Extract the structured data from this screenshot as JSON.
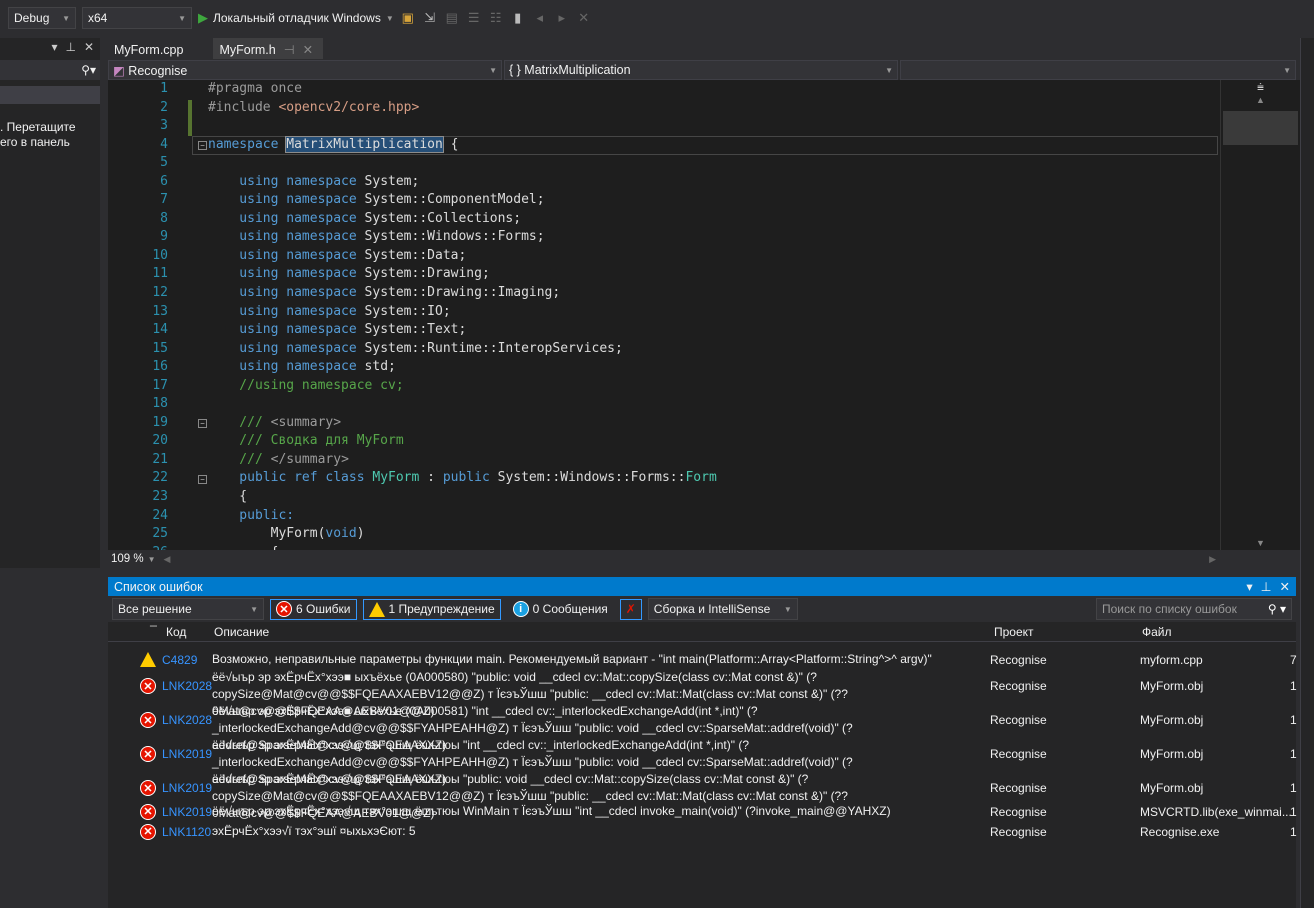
{
  "toolbar": {
    "config": "Debug",
    "platform": "x64",
    "run_label": "Локальный отладчик Windows"
  },
  "left_panel": {
    "hint_line1": ". Перетащите",
    "hint_line2": "его в панель"
  },
  "tabs": [
    {
      "label": "MyForm.cpp",
      "active": false
    },
    {
      "label": "MyForm.h",
      "active": true
    }
  ],
  "navbar": {
    "project": "Recognise",
    "scope": "{ } MatrixMultiplication",
    "member": ""
  },
  "editor": {
    "zoom": "109 %",
    "lines": [
      [
        [
          "#pragma once",
          "p"
        ]
      ],
      [
        [
          "#include ",
          "p"
        ],
        [
          "<opencv2/core.hpp>",
          "s"
        ]
      ],
      [],
      [
        [
          "namespace ",
          "k"
        ],
        [
          "MatrixMultiplication",
          "h"
        ],
        [
          " {",
          ""
        ]
      ],
      [],
      [
        [
          "    using namespace ",
          "k"
        ],
        [
          "System;",
          ""
        ]
      ],
      [
        [
          "    using namespace ",
          "k"
        ],
        [
          "System::ComponentModel;",
          ""
        ]
      ],
      [
        [
          "    using namespace ",
          "k"
        ],
        [
          "System::Collections;",
          ""
        ]
      ],
      [
        [
          "    using namespace ",
          "k"
        ],
        [
          "System::Windows::Forms;",
          ""
        ]
      ],
      [
        [
          "    using namespace ",
          "k"
        ],
        [
          "System::Data;",
          ""
        ]
      ],
      [
        [
          "    using namespace ",
          "k"
        ],
        [
          "System::Drawing;",
          ""
        ]
      ],
      [
        [
          "    using namespace ",
          "k"
        ],
        [
          "System::Drawing::Imaging;",
          ""
        ]
      ],
      [
        [
          "    using namespace ",
          "k"
        ],
        [
          "System::IO;",
          ""
        ]
      ],
      [
        [
          "    using namespace ",
          "k"
        ],
        [
          "System::Text;",
          ""
        ]
      ],
      [
        [
          "    using namespace ",
          "k"
        ],
        [
          "System::Runtime::InteropServices;",
          ""
        ]
      ],
      [
        [
          "    using namespace ",
          "k"
        ],
        [
          "std;",
          ""
        ]
      ],
      [
        [
          "    //using namespace cv;",
          "c"
        ]
      ],
      [],
      [
        [
          "    /// ",
          "c"
        ],
        [
          "<summary>",
          "p"
        ]
      ],
      [
        [
          "    /// Сводка для MyForm",
          "c"
        ]
      ],
      [
        [
          "    /// ",
          "c"
        ],
        [
          "</summary>",
          "p"
        ]
      ],
      [
        [
          "    public ref class ",
          "k"
        ],
        [
          "MyForm",
          "t"
        ],
        [
          " : ",
          ""
        ],
        [
          "public ",
          "k"
        ],
        [
          "System::Windows::Forms::",
          ""
        ],
        [
          "Form",
          "t"
        ]
      ],
      [
        [
          "    {",
          ""
        ]
      ],
      [
        [
          "    public:",
          "k"
        ]
      ],
      [
        [
          "        MyForm(",
          ""
        ],
        [
          "void",
          "k"
        ],
        [
          ")",
          ""
        ]
      ],
      [
        [
          "        {",
          ""
        ]
      ]
    ]
  },
  "error_list": {
    "title": "Список ошибок",
    "scope": "Все решение",
    "errors_label": "6 Ошибки",
    "warnings_label": "1 Предупреждение",
    "messages_label": "0 Сообщения",
    "source": "Сборка и IntelliSense",
    "search_placeholder": "Поиск по списку ошибок",
    "columns": {
      "code": "Код",
      "description": "Описание",
      "project": "Проект",
      "file": "Файл"
    },
    "rows": [
      {
        "type": "warning",
        "code": "C4829",
        "description": "Возможно, неправильные параметры функции main. Рекомендуемый вариант - \"int main(Platform::Array<Platform::String^>^ argv)\"",
        "project": "Recognise",
        "file": "myform.cpp",
        "line": "7"
      },
      {
        "type": "error",
        "code": "LNK2028",
        "description": "ёё√ыър эр эхЁрчЁх°хээ■ ыхъёхье (0A000580) \"public: void __cdecl cv::Mat::copySize(class cv::Mat const &)\" (?copySize@Mat@cv@@$$FQEAAXAEBV12@@Z) т ЇєэъЎшш \"public: __cdecl cv::Mat::Mat(class cv::Mat const &)\" (??0Mat@cv@@$$FQEAA@AEBV01@@Z)",
        "project": "Recognise",
        "file": "MyForm.obj",
        "line": "1"
      },
      {
        "type": "error",
        "code": "LNK2028",
        "description": "ёё√ыър эр эхЁрчЁх°хээ■ ыхъёхье (0A000581) \"int __cdecl cv::_interlockedExchangeAdd(int *,int)\" (?_interlockedExchangeAdd@cv@@$$FYAHPEAHH@Z) т ЇєэъЎшш \"public: void __cdecl cv::SparseMat::addref(void)\" (?addref@SparseMat@cv@@$$FQEAAXXZ)",
        "project": "Recognise",
        "file": "MyForm.obj",
        "line": "1"
      },
      {
        "type": "error",
        "code": "LNK2019",
        "description": "ёё√ыър эр эхЁрчЁх°хээ√щ тэх°эшщ ёшьтюы \"int __cdecl cv::_interlockedExchangeAdd(int *,int)\" (?_interlockedExchangeAdd@cv@@$$FYAHPEAHH@Z) т ЇєэъЎшш \"public: void __cdecl cv::SparseMat::addref(void)\" (?addref@SparseMat@cv@@$$FQEAAXXZ)",
        "project": "Recognise",
        "file": "MyForm.obj",
        "line": "1"
      },
      {
        "type": "error",
        "code": "LNK2019",
        "description": "ёё√ыър эр эхЁрчЁх°хээ√щ тэх°эшщ ёшьтюы \"public: void __cdecl cv::Mat::copySize(class cv::Mat const &)\" (?copySize@Mat@cv@@$$FQEAAXAEBV12@@Z) т ЇєэъЎшш \"public: __cdecl cv::Mat::Mat(class cv::Mat const &)\" (??0Mat@cv@@$$FQEAA@AEBV01@@Z)",
        "project": "Recognise",
        "file": "MyForm.obj",
        "line": "1"
      },
      {
        "type": "error",
        "code": "LNK2019",
        "description": "ёё√ыър эр эхЁрчЁх°хээ√щ тэх°эшщ ёшьтюы WinMain т ЇєэъЎшш \"int __cdecl invoke_main(void)\" (?invoke_main@@YAHXZ)",
        "project": "Recognise",
        "file": "MSVCRTD.lib(exe_winmai...",
        "line": "1"
      },
      {
        "type": "error",
        "code": "LNK1120",
        "description": "эхЁрчЁх°хээ√ї тэх°эшї ¤ыхьхэЄют: 5",
        "project": "Recognise",
        "file": "Recognise.exe",
        "line": "1"
      }
    ]
  },
  "colors": {
    "accent": "#007acc",
    "keyword": "#569cd6",
    "comment": "#57a64a",
    "type": "#4ec9b0",
    "error": "#e51400",
    "warning": "#ffcc00",
    "link": "#3794ff"
  }
}
